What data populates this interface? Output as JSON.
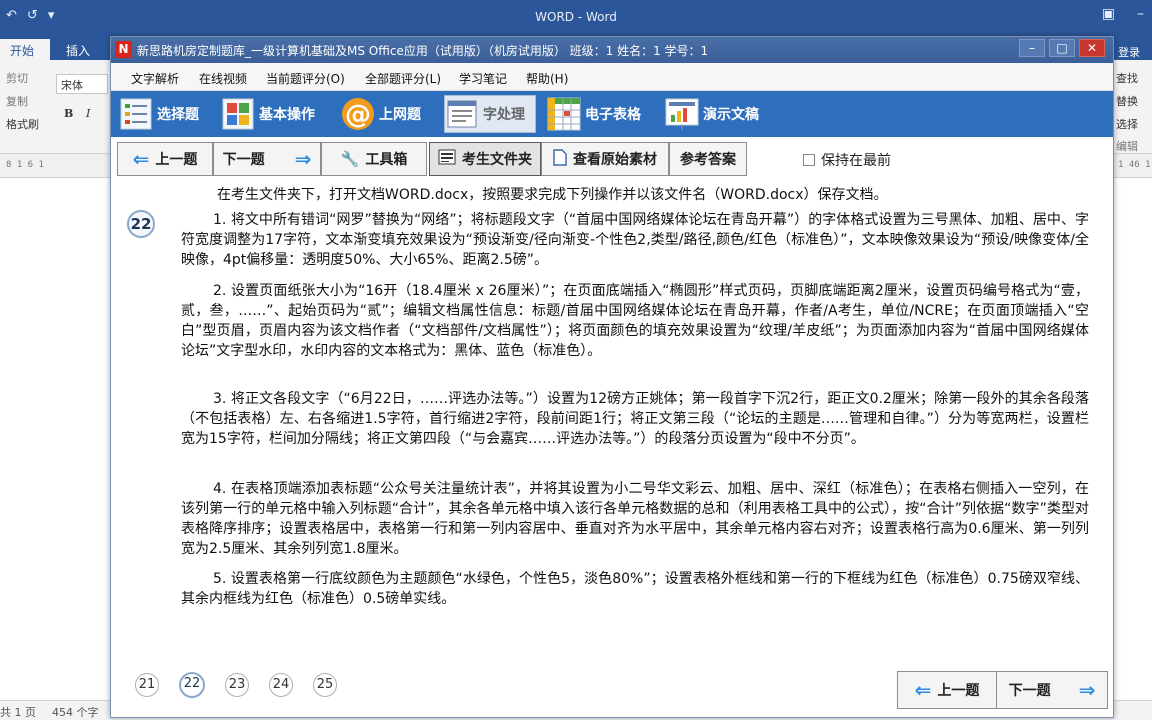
{
  "word": {
    "title": "WORD - Word",
    "tabs": [
      "开始",
      "插入"
    ],
    "font_name": "宋体",
    "clipboard": [
      "剪切",
      "复制",
      "格式刷"
    ],
    "editing": [
      "查找",
      "替换",
      "选择",
      "编辑"
    ],
    "sign_in": "登录",
    "ruler_left": "8 1 6 1",
    "ruler_right": "1 46 1",
    "status_pages": "共 1 页",
    "status_words": "454 个字"
  },
  "exam": {
    "title": "新思路机房定制题库_一级计算机基础及MS Office应用（试用版）（机房试用版）   班级：1 姓名：1 学号：1",
    "menu": [
      "文字解析",
      "在线视频",
      "当前题评分(O)",
      "全部题评分(L)",
      "学习笔记",
      "帮助(H)"
    ],
    "categories": [
      "选择题",
      "基本操作",
      "上网题",
      "字处理",
      "电子表格",
      "演示文稿"
    ],
    "toolbar": {
      "prev": "上一题",
      "next": "下一题",
      "tools": "工具箱",
      "folder": "考生文件夹",
      "material": "查看原始素材",
      "answer": "参考答案",
      "keep_top": "保持在最前"
    },
    "question_number": "22",
    "intro": "在考生文件夹下，打开文档WORD.docx，按照要求完成下列操作并以该文件名（WORD.docx）保存文档。",
    "paragraphs": [
      "1. 将文中所有错词“网罗”替换为“网络”；将标题段文字（“首届中国网络媒体论坛在青岛开幕”）的字体格式设置为三号黑体、加粗、居中、字符宽度调整为17字符，文本渐变填充效果设为“预设渐变/径向渐变-个性色2,类型/路径,颜色/红色（标准色）”，文本映像效果设为“预设/映像变体/全映像，4pt偏移量：透明度50%、大小65%、距离2.5磅”。",
      "2. 设置页面纸张大小为“16开（18.4厘米 x 26厘米）”；在页面底端插入“椭圆形”样式页码，页脚底端距离2厘米，设置页码编号格式为“壹，贰，叁，……”、起始页码为“贰”；编辑文档属性信息：标题/首届中国网络媒体论坛在青岛开幕，作者/A考生，单位/NCRE；在页面顶端插入“空白”型页眉，页眉内容为该文档作者（“文档部件/文档属性”）；将页面颜色的填充效果设置为“纹理/羊皮纸”；为页面添加内容为“首届中国网络媒体论坛”文字型水印，水印内容的文本格式为：黑体、蓝色（标准色）。",
      "3. 将正文各段文字（“6月22日，……评选办法等。”）设置为12磅方正姚体；第一段首字下沉2行，距正文0.2厘米；除第一段外的其余各段落（不包括表格）左、右各缩进1.5字符，首行缩进2字符，段前间距1行；将正文第三段（“论坛的主题是……管理和自律。”）分为等宽两栏，设置栏宽为15字符，栏间加分隔线；将正文第四段（“与会嘉宾……评选办法等。”）的段落分页设置为“段中不分页”。",
      "4. 在表格顶端添加表标题“公众号关注量统计表”，并将其设置为小二号华文彩云、加粗、居中、深红（标准色）；在表格右侧插入一空列，在该列第一行的单元格中输入列标题“合计”，其余各单元格中填入该行各单元格数据的总和（利用表格工具中的公式），按“合计”列依据“数字”类型对表格降序排序；设置表格居中，表格第一行和第一列内容居中、垂直对齐为水平居中，其余单元格内容右对齐；设置表格行高为0.6厘米、第一列列宽为2.5厘米、其余列列宽1.8厘米。",
      "5. 设置表格第一行底纹颜色为主题颜色“水绿色，个性色5，淡色80%”；设置表格外框线和第一行的下框线为红色（标准色）0.75磅双窄线、其余内框线为红色（标准色）0.5磅单实线。"
    ],
    "pages": [
      "21",
      "22",
      "23",
      "24",
      "25"
    ],
    "bottom_prev": "上一题",
    "bottom_next": "下一题"
  }
}
